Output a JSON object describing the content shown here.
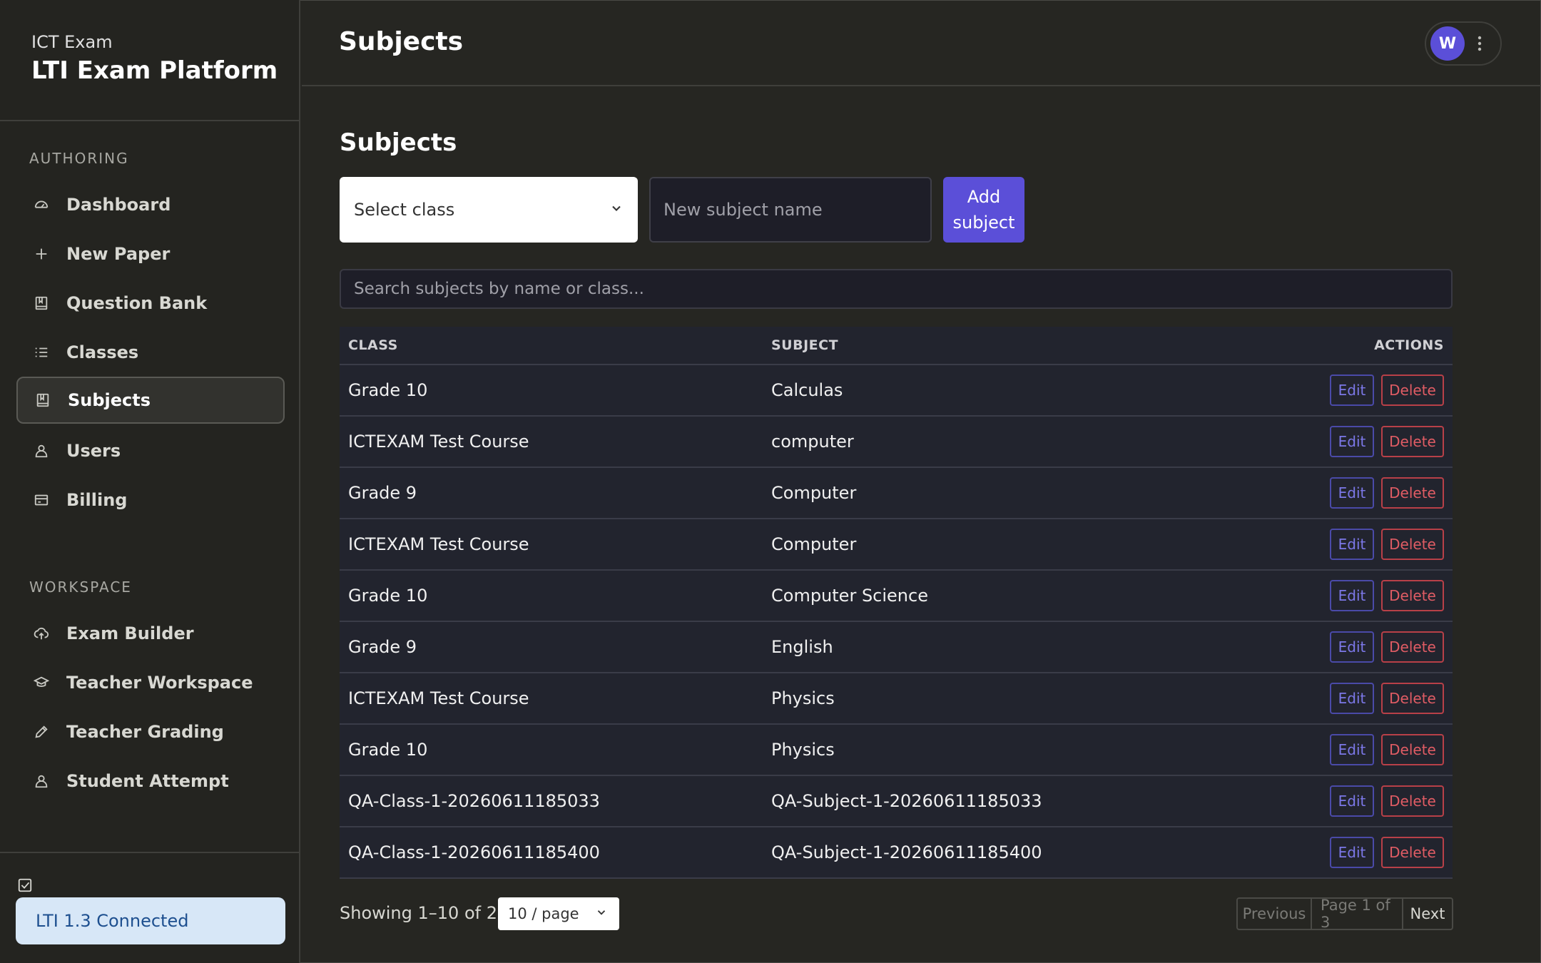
{
  "sidebar": {
    "brand_sub": "ICT Exam",
    "brand_title": "LTI Exam Platform",
    "section_authoring": "AUTHORING",
    "section_workspace": "WORKSPACE",
    "authoring_items": [
      {
        "label": "Dashboard",
        "icon": "gauge-icon"
      },
      {
        "label": "New Paper",
        "icon": "plus-icon"
      },
      {
        "label": "Question Bank",
        "icon": "book-icon"
      },
      {
        "label": "Classes",
        "icon": "list-icon"
      },
      {
        "label": "Subjects",
        "icon": "book-icon",
        "active": true
      },
      {
        "label": "Users",
        "icon": "user-icon"
      },
      {
        "label": "Billing",
        "icon": "card-icon"
      }
    ],
    "workspace_items": [
      {
        "label": "Exam Builder",
        "icon": "cloud-upload-icon"
      },
      {
        "label": "Teacher Workspace",
        "icon": "graduation-cap-icon"
      },
      {
        "label": "Teacher Grading",
        "icon": "pencil-icon"
      },
      {
        "label": "Student Attempt",
        "icon": "user-icon"
      }
    ],
    "lti_status": "LTI 1.3 Connected"
  },
  "header": {
    "title": "Subjects",
    "avatar_initial": "W"
  },
  "main": {
    "title": "Subjects",
    "select_class_label": "Select class",
    "new_subject_placeholder": "New subject name",
    "add_button": "Add subject",
    "search_placeholder": "Search subjects by name or class..."
  },
  "table": {
    "columns": {
      "class": "CLASS",
      "subject": "SUBJECT",
      "actions": "ACTIONS"
    },
    "edit_label": "Edit",
    "delete_label": "Delete",
    "rows": [
      {
        "class": "Grade 10",
        "subject": "Calculas"
      },
      {
        "class": "ICTEXAM Test Course",
        "subject": "computer"
      },
      {
        "class": "Grade 9",
        "subject": "Computer"
      },
      {
        "class": "ICTEXAM Test Course",
        "subject": "Computer"
      },
      {
        "class": "Grade 10",
        "subject": "Computer Science"
      },
      {
        "class": "Grade 9",
        "subject": "English"
      },
      {
        "class": "ICTEXAM Test Course",
        "subject": "Physics"
      },
      {
        "class": "Grade 10",
        "subject": "Physics"
      },
      {
        "class": "QA-Class-1-20260611185033",
        "subject": "QA-Subject-1-20260611185033"
      },
      {
        "class": "QA-Class-1-20260611185400",
        "subject": "QA-Subject-1-20260611185400"
      }
    ]
  },
  "footer": {
    "showing": "Showing 1–10 of 21",
    "per_page": "10 / page",
    "previous": "Previous",
    "page_info": "Page 1 of 3",
    "next": "Next"
  },
  "colors": {
    "accent": "#5b4fd8",
    "danger": "#e05c64",
    "lti_badge_bg": "#d7e7f7"
  }
}
